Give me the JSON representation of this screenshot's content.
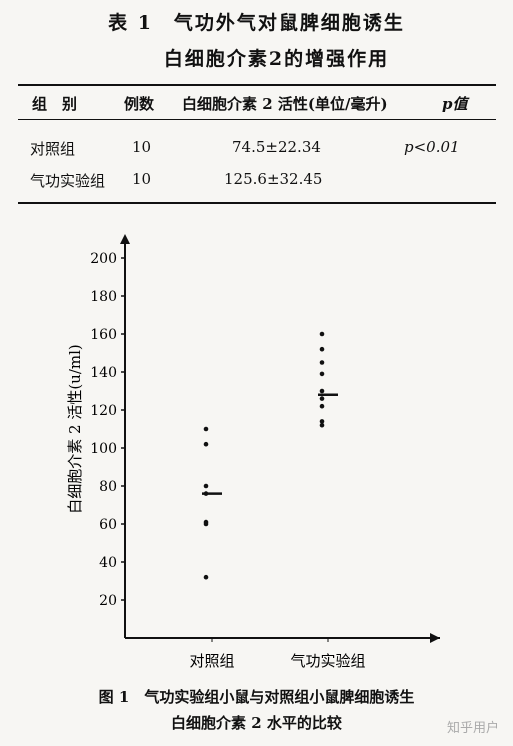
{
  "table": {
    "title_line1": "表 1　气功外气对鼠脾细胞诱生",
    "title_line2": "白细胞介素2的增强作用",
    "headers": [
      "组　别",
      "例数",
      "白细胞介素 2 活性(单位/毫升)",
      "p值"
    ],
    "rows": [
      {
        "group": "对照组",
        "n": "10",
        "activity": "74.5±22.34",
        "p": "p<0.01"
      },
      {
        "group": "气功实验组",
        "n": "10",
        "activity": "125.6±32.45",
        "p": ""
      }
    ]
  },
  "chart_data": {
    "type": "scatter",
    "ylabel": "白细胞介素 2 活性(u/ml)",
    "xlabel": "",
    "ylim": [
      0,
      220
    ],
    "yticks": [
      20,
      40,
      60,
      80,
      100,
      120,
      140,
      160,
      180,
      200
    ],
    "categories": [
      "对照组",
      "气功实验组"
    ],
    "series": [
      {
        "category": "对照组",
        "points": [
          110,
          102,
          80,
          76,
          61,
          60,
          32
        ],
        "mean": 76
      },
      {
        "category": "气功实验组",
        "points": [
          160,
          152,
          145,
          139,
          130,
          126,
          122,
          114,
          112
        ],
        "mean": 128
      }
    ]
  },
  "caption": {
    "line1": "图 1　气功实验组小鼠与对照组小鼠脾细胞诱生",
    "line2": "白细胞介素 2 水平的比较"
  },
  "watermark": "知乎用户"
}
